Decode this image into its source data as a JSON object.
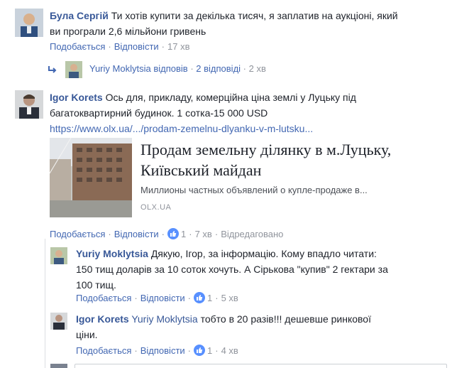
{
  "comment1": {
    "author": "Була Сергій",
    "text_line1": "Ти хотів купити за декілька тисяч, я заплатив на аукціоні, який",
    "text_line2": "ви програли 2,6 мільйони гривень",
    "like_label": "Подобається",
    "reply_label": "Відповісти",
    "time": "17 хв"
  },
  "reply_summary": {
    "author": "Yuriy Moklytsia",
    "verb": "відповів",
    "replies": "2 відповіді",
    "time": "2 хв"
  },
  "comment2": {
    "author": "Igor Korets",
    "text_line1": "Ось для, прикладу, комерційна ціна землі у Луцьку під",
    "text_line2": "багатоквартирний будинок. 1 сотка-15 000 USD",
    "link": "https://www.olx.ua/.../prodam-zemelnu-dlyanku-v-m-lutsku...",
    "card": {
      "title_line1": "Продам земельну ділянку в м.Луцьку,",
      "title_line2": "Київський майдан",
      "description": "Миллионы частных объявлений о купле-продаже в...",
      "domain": "OLX.UA"
    },
    "like_label": "Подобається",
    "reply_label": "Відповісти",
    "likes": "1",
    "time": "7 хв",
    "edited": "Відредаговано"
  },
  "reply1": {
    "author": "Yuriy Moklytsia",
    "text_line1": "Дякую, Ігор, за інформацію. Кому впадло читати:",
    "text_line2": "150 тищ доларів за 10 соток хочуть. А Сірькова \"купив\" 2 гектари за",
    "text_line3": "100 тищ.",
    "like_label": "Подобається",
    "reply_label": "Відповісти",
    "likes": "1",
    "time": "5 хв"
  },
  "reply2": {
    "author": "Igor Korets",
    "mention": "Yuriy Moklytsia",
    "text_line1": "тобто в 20 разів!!! дешевше ринкової",
    "text_line2": "ціни.",
    "like_label": "Подобається",
    "reply_label": "Відповісти",
    "likes": "1",
    "time": "4 хв"
  },
  "colors": {
    "link": "#4267b2",
    "name": "#385898",
    "meta": "#90949c",
    "like_badge": "#5890ff"
  }
}
